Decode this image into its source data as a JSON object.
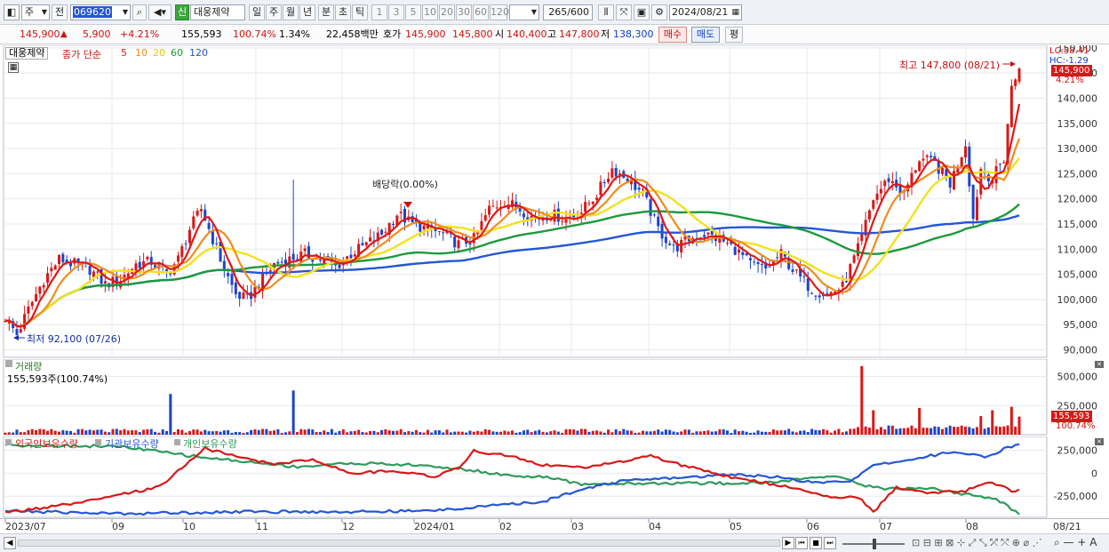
{
  "toolbar": {
    "period_type": "주",
    "compare": "전",
    "code": "069620",
    "badge": "신",
    "name": "대웅제약",
    "periods": [
      "일",
      "주",
      "월",
      "년",
      "분",
      "초",
      "틱"
    ],
    "active_period": "일",
    "intervals": [
      "1",
      "3",
      "5",
      "10",
      "20",
      "30",
      "60",
      "120"
    ],
    "count": "265",
    "count_max": "/600",
    "date": "2024/08/21"
  },
  "info": {
    "price": "145,900",
    "change_arrow": "▲",
    "change": "5,900",
    "change_pct": "+4.21%",
    "volume": "155,593",
    "volume_ratio": "100.74%",
    "turnover": "1.34%",
    "amount": "22,458백만",
    "quote_label": "호가",
    "ask": "145,900",
    "bid": "145,800",
    "open_label": "시",
    "open": "140,400",
    "high_label": "고",
    "high": "147,800",
    "low_label": "저",
    "low": "138,300",
    "buy_label": "매수",
    "sell_label": "매도",
    "avg_label": "평"
  },
  "price_panel": {
    "stock_label": "대웅제약",
    "ma_label": "종가 단순",
    "ma_periods": [
      "5",
      "10",
      "20",
      "60",
      "120"
    ],
    "lc_label": "LC:58.41",
    "hc_label": "HC:-1.29",
    "max_label": "최고 147,800 (08/21)",
    "min_label": "최저 92,100 (07/26)",
    "dividend_label": "배당락(0.00%)",
    "current_tag": "145,900",
    "current_pct": "4.21%"
  },
  "volume_panel": {
    "title": "거래량",
    "value_label": "155,593주(100.74%)",
    "current_tag": "155,593",
    "current_pct": "100.74%"
  },
  "flow_panel": {
    "titles": [
      "외국인보유수량",
      "기관보유수량",
      "개인보유수량"
    ]
  },
  "colors": {
    "ma5": "#e01818",
    "ma10": "#f08c1c",
    "ma20": "#f2e21a",
    "ma60": "#1c9a3c",
    "ma120": "#2456d6",
    "up": "#d81818",
    "down": "#1c44c8",
    "foreign": "#d81818",
    "institution": "#2456d6",
    "individual": "#2e9a5a"
  },
  "chart_data": {
    "type": "candlestick",
    "y_ticks": [
      "150,000",
      "145,000",
      "140,000",
      "135,000",
      "130,000",
      "125,000",
      "120,000",
      "115,000",
      "110,000",
      "105,000",
      "100,000",
      "95,000",
      "90,000"
    ],
    "ylim": [
      88500,
      150500
    ],
    "volume_ticks": [
      "500,000",
      "250,000"
    ],
    "volume_ylim": [
      0,
      650000
    ],
    "flow_ticks": [
      "250,000",
      "0",
      "-250,000"
    ],
    "flow_ylim": [
      -480000,
      400000
    ],
    "x_ticks": [
      "2023/07",
      "09",
      "10",
      "11",
      "12",
      "2024/01",
      "02",
      "03",
      "04",
      "05",
      "06",
      "07",
      "08",
      "08/21"
    ],
    "max_value": 147800,
    "min_value": 92100,
    "close_keys": [
      [
        0,
        96500
      ],
      [
        3,
        93000
      ],
      [
        6,
        98000
      ],
      [
        10,
        104000
      ],
      [
        14,
        108000
      ],
      [
        18,
        107000
      ],
      [
        22,
        106000
      ],
      [
        26,
        103000
      ],
      [
        30,
        104000
      ],
      [
        34,
        107000
      ],
      [
        38,
        107500
      ],
      [
        42,
        105000
      ],
      [
        45,
        108000
      ],
      [
        48,
        114000
      ],
      [
        51,
        118000
      ],
      [
        54,
        112000
      ],
      [
        57,
        106000
      ],
      [
        60,
        101000
      ],
      [
        63,
        100000
      ],
      [
        66,
        103000
      ],
      [
        70,
        107000
      ],
      [
        74,
        108000
      ],
      [
        78,
        109000
      ],
      [
        82,
        108000
      ],
      [
        86,
        106500
      ],
      [
        90,
        109000
      ],
      [
        94,
        111000
      ],
      [
        98,
        113000
      ],
      [
        102,
        117000
      ],
      [
        106,
        115000
      ],
      [
        110,
        114000
      ],
      [
        114,
        113000
      ],
      [
        118,
        111000
      ],
      [
        122,
        112000
      ],
      [
        126,
        118000
      ],
      [
        130,
        119500
      ],
      [
        134,
        118000
      ],
      [
        138,
        116000
      ],
      [
        142,
        117000
      ],
      [
        146,
        116000
      ],
      [
        150,
        117500
      ],
      [
        154,
        121000
      ],
      [
        158,
        126000
      ],
      [
        162,
        124000
      ],
      [
        166,
        121000
      ],
      [
        170,
        114000
      ],
      [
        174,
        110000
      ],
      [
        178,
        112000
      ],
      [
        182,
        113000
      ],
      [
        186,
        112000
      ],
      [
        190,
        110000
      ],
      [
        194,
        107000
      ],
      [
        198,
        106000
      ],
      [
        202,
        109000
      ],
      [
        206,
        105000
      ],
      [
        210,
        102000
      ],
      [
        214,
        101000
      ],
      [
        218,
        102500
      ],
      [
        222,
        110000
      ],
      [
        226,
        120000
      ],
      [
        230,
        124000
      ],
      [
        234,
        121000
      ],
      [
        238,
        128000
      ],
      [
        242,
        127000
      ],
      [
        246,
        123000
      ],
      [
        250,
        131000
      ],
      [
        252,
        116000
      ],
      [
        254,
        126000
      ],
      [
        257,
        124000
      ],
      [
        260,
        128000
      ],
      [
        262,
        142000
      ],
      [
        264,
        145900
      ]
    ],
    "foreign_keys": [
      [
        0,
        -430000
      ],
      [
        20,
        -320000
      ],
      [
        40,
        -150000
      ],
      [
        52,
        270000
      ],
      [
        60,
        180000
      ],
      [
        70,
        100000
      ],
      [
        80,
        150000
      ],
      [
        90,
        0
      ],
      [
        100,
        20000
      ],
      [
        106,
        10000
      ],
      [
        112,
        -40000
      ],
      [
        118,
        60000
      ],
      [
        122,
        240000
      ],
      [
        130,
        200000
      ],
      [
        140,
        90000
      ],
      [
        150,
        60000
      ],
      [
        160,
        120000
      ],
      [
        168,
        190000
      ],
      [
        176,
        90000
      ],
      [
        186,
        -20000
      ],
      [
        196,
        -90000
      ],
      [
        206,
        -170000
      ],
      [
        216,
        -260000
      ],
      [
        222,
        -260000
      ],
      [
        226,
        -420000
      ],
      [
        232,
        -160000
      ],
      [
        240,
        -210000
      ],
      [
        250,
        -190000
      ],
      [
        256,
        -90000
      ],
      [
        262,
        -190000
      ],
      [
        264,
        -180000
      ]
    ],
    "institution_keys": [
      [
        0,
        -410000
      ],
      [
        30,
        -440000
      ],
      [
        60,
        -420000
      ],
      [
        90,
        -420000
      ],
      [
        110,
        -410000
      ],
      [
        122,
        -370000
      ],
      [
        140,
        -310000
      ],
      [
        150,
        -170000
      ],
      [
        160,
        -90000
      ],
      [
        170,
        -60000
      ],
      [
        180,
        -40000
      ],
      [
        190,
        -10000
      ],
      [
        200,
        -40000
      ],
      [
        212,
        -110000
      ],
      [
        220,
        -80000
      ],
      [
        226,
        80000
      ],
      [
        236,
        150000
      ],
      [
        246,
        230000
      ],
      [
        256,
        180000
      ],
      [
        260,
        270000
      ],
      [
        264,
        310000
      ]
    ],
    "individual_keys": [
      [
        0,
        310000
      ],
      [
        30,
        290000
      ],
      [
        50,
        180000
      ],
      [
        66,
        110000
      ],
      [
        76,
        70000
      ],
      [
        90,
        110000
      ],
      [
        106,
        90000
      ],
      [
        118,
        50000
      ],
      [
        130,
        -20000
      ],
      [
        142,
        -50000
      ],
      [
        150,
        -120000
      ],
      [
        162,
        -110000
      ],
      [
        176,
        -110000
      ],
      [
        190,
        -110000
      ],
      [
        200,
        -100000
      ],
      [
        208,
        -60000
      ],
      [
        216,
        -20000
      ],
      [
        222,
        -120000
      ],
      [
        230,
        -170000
      ],
      [
        240,
        -160000
      ],
      [
        250,
        -230000
      ],
      [
        258,
        -280000
      ],
      [
        264,
        -440000
      ]
    ],
    "volume_spikes": [
      [
        43,
        350000
      ],
      [
        75,
        380000
      ],
      [
        223,
        590000
      ],
      [
        226,
        210000
      ],
      [
        238,
        230000
      ],
      [
        254,
        160000
      ],
      [
        257,
        210000
      ],
      [
        262,
        240000
      ],
      [
        264,
        155593
      ]
    ],
    "series": [
      {
        "name": "종가"
      },
      {
        "name": "5"
      },
      {
        "name": "10"
      },
      {
        "name": "20"
      },
      {
        "name": "60"
      },
      {
        "name": "120"
      }
    ]
  }
}
